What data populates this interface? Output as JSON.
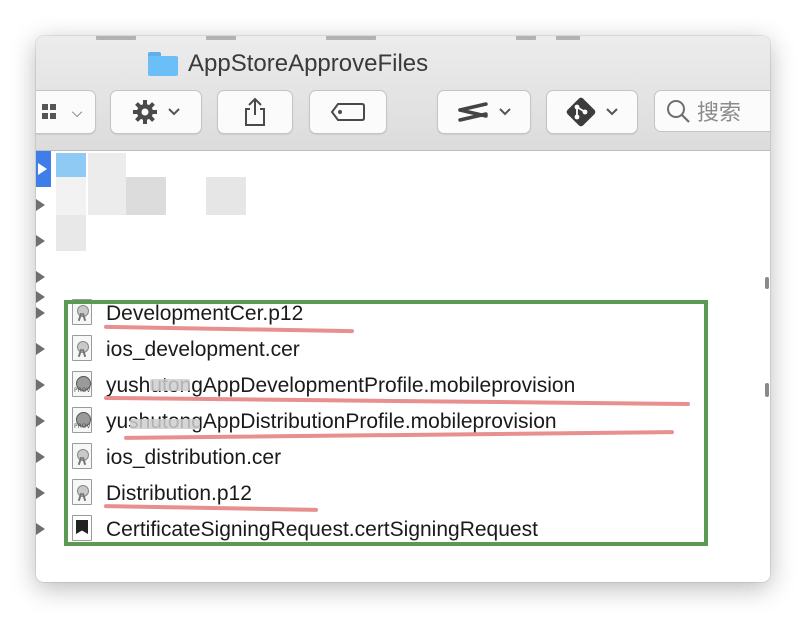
{
  "window": {
    "title": "AppStoreApproveFiles"
  },
  "toolbar": {
    "view_label": "",
    "action_label": "",
    "share_label": "",
    "tags_label": "",
    "sourcetree_label": "",
    "git_label": "",
    "search_placeholder": "搜索"
  },
  "files": [
    {
      "name": "DevelopmentCer.p12",
      "icon": "p12-certificate-icon"
    },
    {
      "name": "ios_development.cer",
      "icon": "cer-certificate-icon"
    },
    {
      "name": "yushutongAppDevelopmentProfile.mobileprovision",
      "icon": "mobileprovision-icon"
    },
    {
      "name": "yushutongAppDistributionProfile.mobileprovision",
      "icon": "mobileprovision-icon"
    },
    {
      "name": "ios_distribution.cer",
      "icon": "cer-certificate-icon"
    },
    {
      "name": "Distribution.p12",
      "icon": "p12-certificate-icon"
    },
    {
      "name": "CertificateSigningRequest.certSigningRequest",
      "icon": "signing-request-icon"
    }
  ],
  "colors": {
    "selection": "#3f7ee8",
    "highlight_box": "#5a9a52",
    "underline": "#e88f8f",
    "folder": "#6ac0f6"
  }
}
